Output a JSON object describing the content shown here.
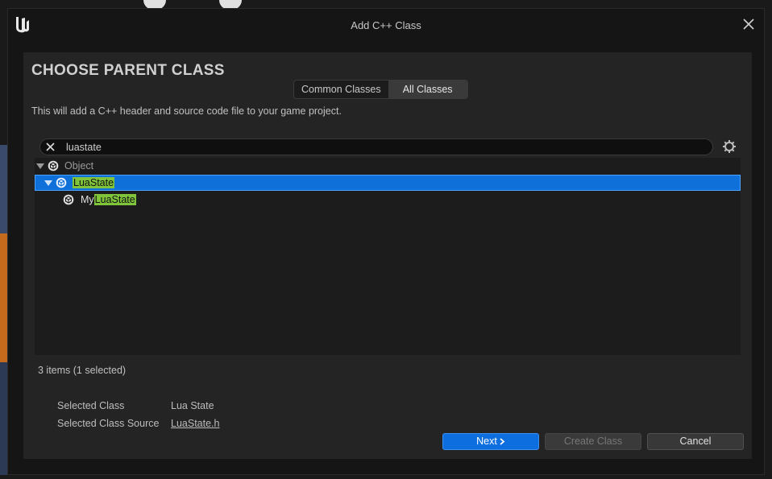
{
  "window": {
    "title": "Add C++ Class",
    "icon": "unreal-logo-icon"
  },
  "header": {
    "heading": "CHOOSE PARENT CLASS"
  },
  "tabs": [
    {
      "label": "Common Classes",
      "active": false
    },
    {
      "label": "All Classes",
      "active": true
    }
  ],
  "description": "This will add a C++ header and source code file to your game project.",
  "search": {
    "value": "luastate",
    "placeholder": ""
  },
  "tree": {
    "rows": [
      {
        "label": "Object",
        "prefix": "",
        "match": "",
        "expanded": true,
        "selected": false
      },
      {
        "label": "",
        "prefix": "",
        "match": "LuaState",
        "expanded": true,
        "selected": true
      },
      {
        "label": "",
        "prefix": "My",
        "match": "LuaState",
        "expanded": false,
        "selected": false
      }
    ]
  },
  "status": {
    "count_text": "3 items (1 selected)"
  },
  "details": {
    "selected_class_label": "Selected Class",
    "selected_class_value": "Lua State",
    "source_label": "Selected Class Source",
    "source_value": "LuaState.h"
  },
  "buttons": {
    "next": "Next",
    "create": "Create Class",
    "cancel": "Cancel"
  },
  "colors": {
    "accent": "#0e70d8",
    "highlight": "#7fc43a",
    "panel": "#242424"
  }
}
